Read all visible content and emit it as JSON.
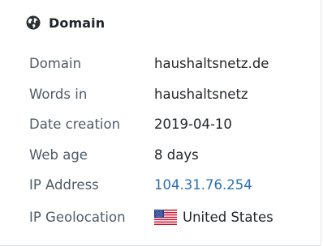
{
  "section": {
    "title": "Domain",
    "icon": "globe-icon"
  },
  "rows": [
    {
      "label": "Domain",
      "value": "haushaltsnetz.de"
    },
    {
      "label": "Words in",
      "value": "haushaltsnetz"
    },
    {
      "label": "Date creation",
      "value": "2019-04-10"
    },
    {
      "label": "Web age",
      "value": "8 days"
    },
    {
      "label": "IP Address",
      "value": "104.31.76.254"
    },
    {
      "label": "IP Geolocation",
      "value": "United States",
      "flag_icon": "us-flag-icon"
    }
  ],
  "colors": {
    "label": "#4f5a66",
    "value": "#212529",
    "link": "#2a6fb0"
  }
}
